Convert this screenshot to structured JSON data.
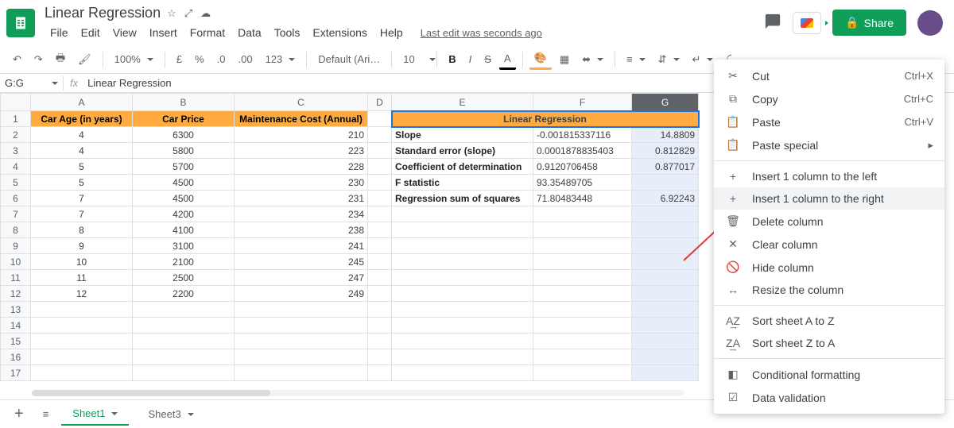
{
  "doc": {
    "title": "Linear Regression"
  },
  "menubar": [
    "File",
    "Edit",
    "View",
    "Insert",
    "Format",
    "Data",
    "Tools",
    "Extensions",
    "Help"
  ],
  "last_edit": "Last edit was seconds ago",
  "share_label": "Share",
  "toolbar": {
    "zoom": "100%",
    "font": "Default (Ari…",
    "size": "10",
    "currency": "£",
    "percent": "%",
    "dec_dec": ".0",
    "inc_dec": ".00",
    "num_fmt": "123"
  },
  "namebox": "G:G",
  "formula": "Linear Regression",
  "columns": [
    "A",
    "B",
    "C",
    "D",
    "E",
    "F",
    "G"
  ],
  "col_widths": {
    "A": 128,
    "B": 128,
    "C": 168,
    "D": 30
  },
  "headers": {
    "a": "Car Age (in years)",
    "b": "Car Price",
    "c": "Maintenance Cost (Annual)",
    "efg": "Linear Regression"
  },
  "rows": [
    {
      "a": "4",
      "b": "6300",
      "c": "210",
      "e": "Slope",
      "f": "-0.001815337116",
      "g": "14.8809"
    },
    {
      "a": "4",
      "b": "5800",
      "c": "223",
      "e": "Standard error (slope)",
      "f": "0.0001878835403",
      "g": "0.812829"
    },
    {
      "a": "5",
      "b": "5700",
      "c": "228",
      "e": "Coefficient of determination",
      "f": "0.9120706458",
      "g": "0.877017"
    },
    {
      "a": "5",
      "b": "4500",
      "c": "230",
      "e": "F statistic",
      "f": "93.35489705",
      "g": ""
    },
    {
      "a": "7",
      "b": "4500",
      "c": "231",
      "e": "Regression sum of squares",
      "f": "71.80483448",
      "g": "6.92243"
    },
    {
      "a": "7",
      "b": "4200",
      "c": "234",
      "e": "",
      "f": "",
      "g": ""
    },
    {
      "a": "8",
      "b": "4100",
      "c": "238",
      "e": "",
      "f": "",
      "g": ""
    },
    {
      "a": "9",
      "b": "3100",
      "c": "241",
      "e": "",
      "f": "",
      "g": ""
    },
    {
      "a": "10",
      "b": "2100",
      "c": "245",
      "e": "",
      "f": "",
      "g": ""
    },
    {
      "a": "11",
      "b": "2500",
      "c": "247",
      "e": "",
      "f": "",
      "g": ""
    },
    {
      "a": "12",
      "b": "2200",
      "c": "249",
      "e": "",
      "f": "",
      "g": ""
    }
  ],
  "empty_rows": [
    13,
    14,
    15,
    16,
    17
  ],
  "context_menu": {
    "cut": {
      "label": "Cut",
      "shortcut": "Ctrl+X"
    },
    "copy": {
      "label": "Copy",
      "shortcut": "Ctrl+C"
    },
    "paste": {
      "label": "Paste",
      "shortcut": "Ctrl+V"
    },
    "paste_special": {
      "label": "Paste special"
    },
    "insert_left": {
      "label": "Insert 1 column to the left"
    },
    "insert_right": {
      "label": "Insert 1 column to the right"
    },
    "delete_col": {
      "label": "Delete column"
    },
    "clear_col": {
      "label": "Clear column"
    },
    "hide_col": {
      "label": "Hide column"
    },
    "resize_col": {
      "label": "Resize the column"
    },
    "sort_az": {
      "label": "Sort sheet A to Z"
    },
    "sort_za": {
      "label": "Sort sheet Z to A"
    },
    "cond_fmt": {
      "label": "Conditional formatting"
    },
    "data_val": {
      "label": "Data validation"
    }
  },
  "sheets": {
    "active": "Sheet1",
    "other": "Sheet3"
  }
}
